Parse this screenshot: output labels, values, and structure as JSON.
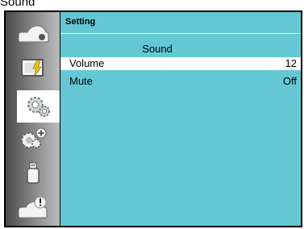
{
  "page_heading": "Sound",
  "panel": {
    "title": "Setting",
    "section_title": "Sound"
  },
  "menu_rows": [
    {
      "label": "Volume",
      "value": "12",
      "selected": true
    },
    {
      "label": "Mute",
      "value": "Off",
      "selected": false
    }
  ],
  "sidebar_icons": [
    {
      "name": "display-icon"
    },
    {
      "name": "image-adjust-icon"
    },
    {
      "name": "setting-gears-icon",
      "active": true
    },
    {
      "name": "expanded-setting-icon"
    },
    {
      "name": "usb-icon"
    },
    {
      "name": "info-icon"
    }
  ],
  "colors": {
    "panel_bg": "#64c8d4",
    "highlight": "#ffffff",
    "frame": "#000000"
  }
}
